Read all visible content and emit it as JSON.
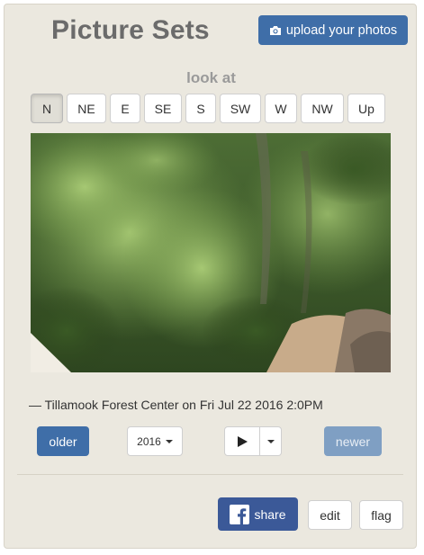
{
  "header": {
    "title": "Picture Sets",
    "upload_label": "upload your photos"
  },
  "look_at": {
    "label": "look at",
    "directions": [
      "N",
      "NE",
      "E",
      "SE",
      "S",
      "SW",
      "W",
      "NW",
      "Up"
    ],
    "selected": "N"
  },
  "photo": {
    "caption": "— Tillamook Forest Center on Fri Jul 22 2016 2:0PM"
  },
  "nav": {
    "older_label": "older",
    "year_value": "2016",
    "newer_label": "newer"
  },
  "actions": {
    "share_label": "share",
    "edit_label": "edit",
    "flag_label": "flag"
  },
  "colors": {
    "panel_bg": "#ebe8df",
    "primary_blue": "#3f6ea8",
    "disabled_blue": "#7f9fc3",
    "facebook_blue": "#3b5998"
  }
}
